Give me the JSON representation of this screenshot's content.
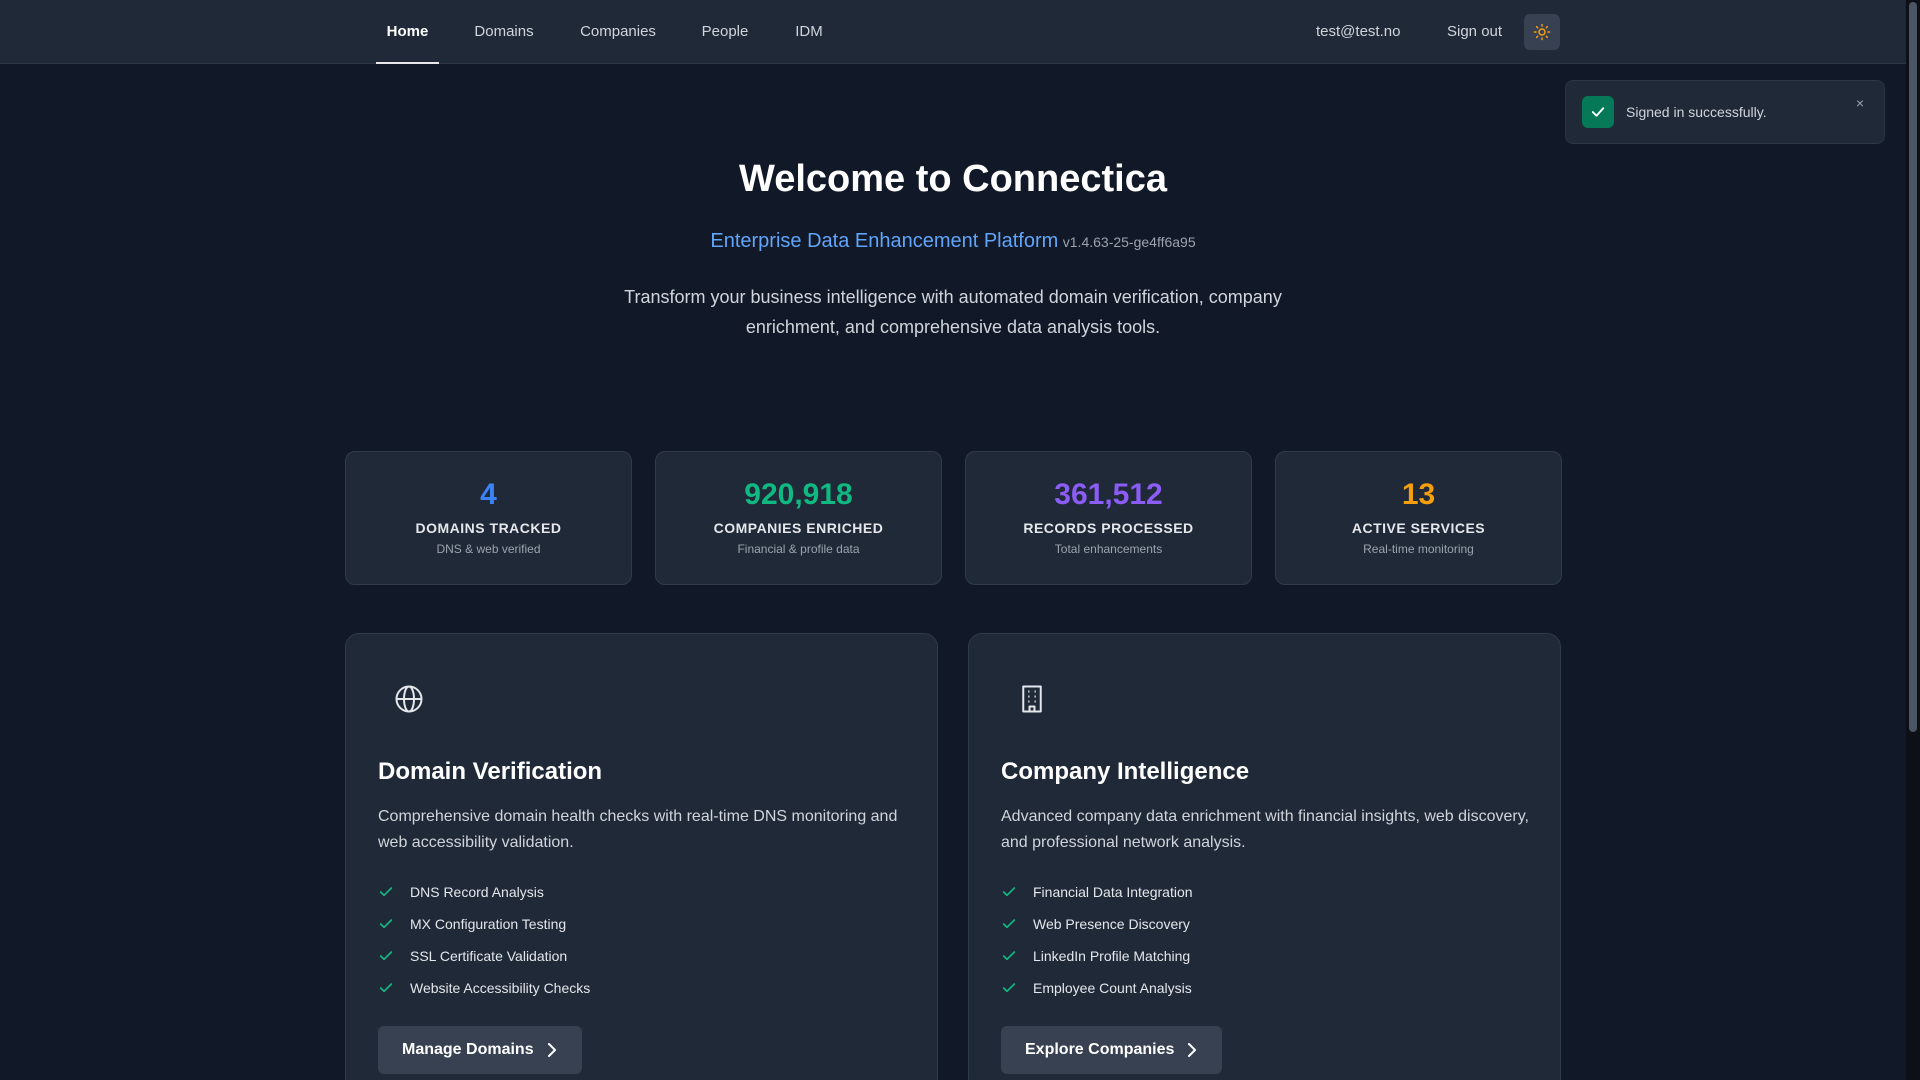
{
  "nav": {
    "links": [
      {
        "label": "Home",
        "active": true
      },
      {
        "label": "Domains"
      },
      {
        "label": "Companies"
      },
      {
        "label": "People"
      },
      {
        "label": "IDM"
      }
    ],
    "user_email": "test@test.no",
    "sign_out_label": "Sign out",
    "theme_icon": "sun-icon"
  },
  "toast": {
    "message": "Signed in successfully.",
    "close_label": "×",
    "icon": "check-icon"
  },
  "hero": {
    "title": "Welcome to Connectica",
    "platform": "Enterprise Data Enhancement Platform",
    "version": "v1.4.63-25-ge4ff6a95",
    "description": "Transform your business intelligence with automated domain verification, company enrichment, and comprehensive data analysis tools."
  },
  "stats": [
    {
      "value": "4",
      "label": "DOMAINS TRACKED",
      "sub": "DNS & web verified",
      "color": "#3b82f6"
    },
    {
      "value": "920,918",
      "label": "COMPANIES ENRICHED",
      "sub": "Financial & profile data",
      "color": "#10b981"
    },
    {
      "value": "361,512",
      "label": "RECORDS PROCESSED",
      "sub": "Total enhancements",
      "color": "#8b5cf6"
    },
    {
      "value": "13",
      "label": "ACTIVE SERVICES",
      "sub": "Real-time monitoring",
      "color": "#f59e0b"
    }
  ],
  "cards": [
    {
      "icon": "globe-icon",
      "title": "Domain Verification",
      "description": "Comprehensive domain health checks with real-time DNS monitoring and web accessibility validation.",
      "features": [
        "DNS Record Analysis",
        "MX Configuration Testing",
        "SSL Certificate Validation",
        "Website Accessibility Checks"
      ],
      "button": "Manage Domains"
    },
    {
      "icon": "building-icon",
      "title": "Company Intelligence",
      "description": "Advanced company data enrichment with financial insights, web discovery, and professional network analysis.",
      "features": [
        "Financial Data Integration",
        "Web Presence Discovery",
        "LinkedIn Profile Matching",
        "Employee Count Analysis"
      ],
      "button": "Explore Companies"
    }
  ],
  "colors": {
    "background": "#111827",
    "surface": "#1f2937",
    "accent_blue": "#60a5fa",
    "check_green": "#10b981"
  }
}
